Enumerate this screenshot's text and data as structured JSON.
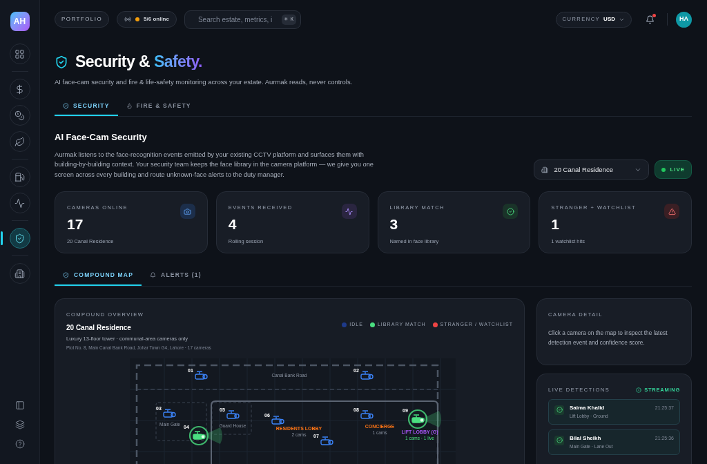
{
  "sidebar": {
    "logo": "AH",
    "items": [
      {
        "kind": "grid",
        "selected": false
      },
      {
        "kind": "dollar",
        "selected": false
      },
      {
        "kind": "coins",
        "selected": false
      },
      {
        "kind": "leaf",
        "selected": false
      },
      {
        "kind": "fuel",
        "selected": false
      },
      {
        "kind": "activity",
        "selected": false
      },
      {
        "kind": "shield",
        "selected": true
      },
      {
        "kind": "building",
        "selected": false
      }
    ],
    "footer_items": [
      {
        "kind": "panel"
      },
      {
        "kind": "layers"
      },
      {
        "kind": "help"
      }
    ]
  },
  "topbar": {
    "portfolio": "PORTFOLIO",
    "status": "5/6 online",
    "search": {
      "placeholder": "Search estate, metrics, i",
      "shortcut": "⌘ K"
    },
    "currency": {
      "label": "CURRENCY",
      "value": "USD"
    },
    "notification": true,
    "avatar": "HA"
  },
  "page": {
    "title": "Security &",
    "title_accent": "Safety.",
    "subtitle": "AI face-cam security and fire & life-safety monitoring across your estate. Aurmak reads, never controls.",
    "tabs": [
      {
        "label": "SECURITY",
        "kind": "shield",
        "selected": true
      },
      {
        "label": "FIRE & SAFETY",
        "kind": "flame",
        "selected": false
      }
    ]
  },
  "section": {
    "title": "AI Face-Cam Security",
    "description": "Aurmak listens to the face-recognition events emitted by your existing CCTV platform and surfaces them with building-by-building context. Your security team keeps the face library in the camera platform — we give you one screen across every building and route unknown-face alerts to the duty manager.",
    "building": "20 Canal Residence",
    "live": true,
    "live_label": "LIVE"
  },
  "stats": [
    {
      "label": "CAMERAS ONLINE",
      "value": "17",
      "sub": "20 Canal Residence",
      "kind": "camera"
    },
    {
      "label": "EVENTS RECEIVED",
      "value": "4",
      "sub": "Rolling session",
      "kind": "activity"
    },
    {
      "label": "LIBRARY MATCH",
      "value": "3",
      "sub": "Named in face library",
      "kind": "match"
    },
    {
      "label": "STRANGER + WATCHLIST",
      "value": "1",
      "sub": "1 watchlist hits",
      "kind": "alert"
    }
  ],
  "subtabs": [
    {
      "label": "COMPOUND MAP",
      "kind": "shield",
      "selected": true
    },
    {
      "label": "ALERTS (1)",
      "kind": "bell",
      "selected": false
    }
  ],
  "map": {
    "eyebrow": "COMPOUND OVERVIEW",
    "title": "20 Canal Residence",
    "description": "Luxury 13-floor tower · communal-area cameras only",
    "address": "Plot No. 8, Main Canal Bank Road, Johar Town G4, Lahore · 17 cameras",
    "legend": [
      {
        "label": "IDLE",
        "color": "#1e3a8a"
      },
      {
        "label": "LIBRARY MATCH",
        "color": "#4ade80"
      },
      {
        "label": "STRANGER / WATCHLIST",
        "color": "#ef4444"
      }
    ],
    "zones": [
      {
        "label": "Canal Bank Road",
        "kind": "road"
      },
      {
        "label": "Main Gate",
        "kind": "area"
      },
      {
        "label": "Guard House",
        "kind": "area"
      },
      {
        "label": "RESIDENTS LOBBY",
        "sub": "2 cams",
        "kind": "hall"
      },
      {
        "label": "CONCIERGE",
        "sub": "1 cams",
        "kind": "hall"
      },
      {
        "label": "LIFT LOBBY (G)",
        "sub": "1 cams · 1 live",
        "kind": "live"
      }
    ],
    "cameras": [
      {
        "id": "01",
        "kind": "idle"
      },
      {
        "id": "02",
        "kind": "idle"
      },
      {
        "id": "03",
        "kind": "idle"
      },
      {
        "id": "04",
        "kind": "match"
      },
      {
        "id": "05",
        "kind": "idle"
      },
      {
        "id": "06",
        "kind": "idle"
      },
      {
        "id": "07",
        "kind": "idle"
      },
      {
        "id": "08",
        "kind": "idle"
      },
      {
        "id": "09",
        "kind": "match"
      }
    ]
  },
  "camera_detail": {
    "title": "CAMERA DETAIL",
    "text": "Click a camera on the map to inspect the latest detection event and confidence score."
  },
  "detections": {
    "title": "LIVE DETECTIONS",
    "status": "STREAMING",
    "items": [
      {
        "name": "Saima Khalid",
        "location": "Lift Lobby · Ground",
        "time": "21:25:37",
        "kind": "match"
      },
      {
        "name": "Bilal Sheikh",
        "location": "Main Gate · Lane Out",
        "time": "21:25:36",
        "kind": "match"
      }
    ]
  }
}
